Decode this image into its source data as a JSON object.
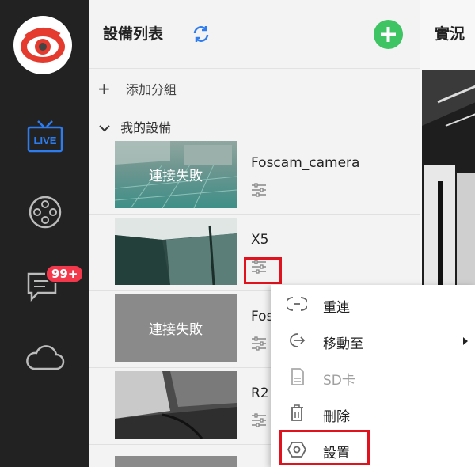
{
  "nav": {
    "items": [
      {
        "name": "live",
        "label": "LIVE"
      },
      {
        "name": "playback"
      },
      {
        "name": "messages",
        "badge": "99+"
      },
      {
        "name": "cloud"
      }
    ]
  },
  "panel": {
    "title": "設備列表",
    "add_group": "添加分組",
    "my_devices": "我的設備"
  },
  "devices": [
    {
      "name": "Foscam_camera",
      "status": "連接失敗"
    },
    {
      "name": "X5",
      "status": ""
    },
    {
      "name": "Fos",
      "status": "連接失敗"
    },
    {
      "name": "R2",
      "status": ""
    }
  ],
  "live": {
    "title": "實況"
  },
  "context_menu": {
    "items": [
      {
        "label": "重連",
        "icon": "reconnect-icon",
        "disabled": false
      },
      {
        "label": "移動至",
        "icon": "move-icon",
        "disabled": false,
        "submenu": true
      },
      {
        "label": "SD卡",
        "icon": "sd-card-icon",
        "disabled": true
      },
      {
        "label": "刪除",
        "icon": "trash-icon",
        "disabled": false
      },
      {
        "label": "設置",
        "icon": "settings-icon",
        "disabled": false
      }
    ]
  },
  "colors": {
    "sidebar": "#222222",
    "accent": "#2a6fdb",
    "add": "#3fc463",
    "badge": "#f3384b",
    "highlight": "#e0121e"
  }
}
